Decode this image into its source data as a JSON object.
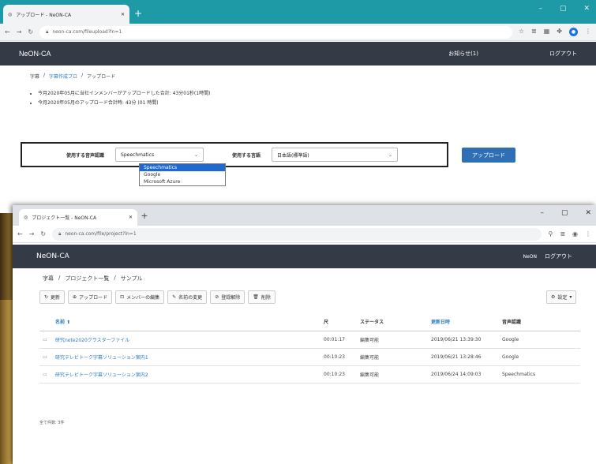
{
  "window1": {
    "tab_title": "アップロード - NeON-CA",
    "url": "neon-ca.com/fileupload?ln=1",
    "brand": "NeON-CA",
    "nav": [
      "お知らせ(1)",
      "ログアウト"
    ],
    "breadcrumb": [
      "字幕",
      "字幕作成プロ",
      "アップロード"
    ],
    "notes": [
      "今月2020年05月に当社インメンバーがアップロードした合計: 43分01秒(1時間)",
      "今月2020年05月のアップロード合計時: 43分 (01 時間)"
    ],
    "form": {
      "engine_label": "使用する音声認識",
      "engine_value": "Speechmatics",
      "lang_label": "使用する言語",
      "lang_value": "日本語(標準語)",
      "upload_label": "アップロード",
      "options": [
        "Speechmatics",
        "Google",
        "Microsoft Azure"
      ]
    }
  },
  "window2": {
    "tab_title": "プロジェクト一覧 - NeON-CA",
    "url": "neon-ca.com/file/project?ln=1",
    "brand": "NeON-CA",
    "user": "NeON",
    "nav": "ログアウト",
    "breadcrumb": [
      "字幕",
      "プロジェクト一覧",
      "サンプル"
    ],
    "toolbar": [
      "更新",
      "アップロード",
      "メンバーの編集",
      "名前の変更",
      "登録解除",
      "削除"
    ],
    "settings_label": "設定",
    "table": {
      "headers": [
        "名前",
        "尺",
        "ステータス",
        "更新日時",
        "音声認識"
      ],
      "rows": [
        {
          "name": "研究note2020クラスターファイル",
          "duration": "00:01:17",
          "status": "編集可能",
          "updated": "2019/06/21 13:39:30",
          "engine": "Google"
        },
        {
          "name": "研究テレビトーク字幕ソリューション案内1",
          "duration": "00:10:23",
          "status": "編集可能",
          "updated": "2019/06/21 13:28:46",
          "engine": "Google"
        },
        {
          "name": "研究テレビトーク字幕ソリューション案内2",
          "duration": "00:10:23",
          "status": "編集可能",
          "updated": "2019/06/24 14:09:03",
          "engine": "Speechmatics"
        }
      ]
    },
    "footer": "全て件数: 3件"
  }
}
